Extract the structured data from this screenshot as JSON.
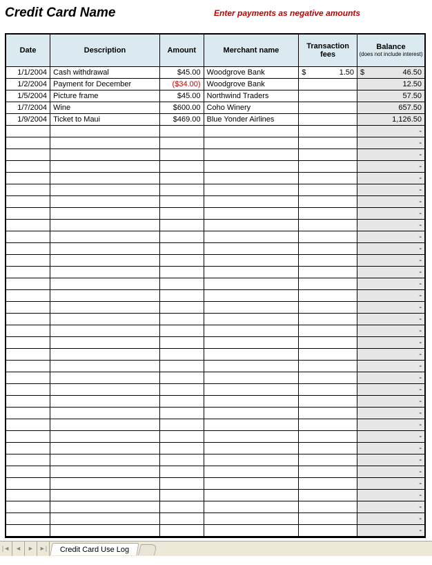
{
  "title": "Credit Card Name",
  "hint": "Enter payments as negative amounts",
  "headers": {
    "date": "Date",
    "desc": "Description",
    "amount": "Amount",
    "merchant": "Merchant name",
    "fees": "Transaction fees",
    "balance": "Balance",
    "balance_sub": "(does not include interest)"
  },
  "rows": [
    {
      "date": "1/1/2004",
      "desc": "Cash withdrawal",
      "amount": "$45.00",
      "neg": false,
      "merchant": "Woodgrove Bank",
      "fees_cur": "$",
      "fees": "1.50",
      "bal_cur": "$",
      "balance": "46.50"
    },
    {
      "date": "1/2/2004",
      "desc": "Payment for December",
      "amount": "($34.00)",
      "neg": true,
      "merchant": "Woodgrove Bank",
      "fees_cur": "",
      "fees": "",
      "bal_cur": "",
      "balance": "12.50"
    },
    {
      "date": "1/5/2004",
      "desc": "Picture frame",
      "amount": "$45.00",
      "neg": false,
      "merchant": "Northwind Traders",
      "fees_cur": "",
      "fees": "",
      "bal_cur": "",
      "balance": "57.50"
    },
    {
      "date": "1/7/2004",
      "desc": "Wine",
      "amount": "$600.00",
      "neg": false,
      "merchant": "Coho Winery",
      "fees_cur": "",
      "fees": "",
      "bal_cur": "",
      "balance": "657.50"
    },
    {
      "date": "1/9/2004",
      "desc": "Ticket to Maui",
      "amount": "$469.00",
      "neg": false,
      "merchant": "Blue Yonder Airlines",
      "fees_cur": "",
      "fees": "",
      "bal_cur": "",
      "balance": "1,126.50"
    }
  ],
  "empty_row_count": 35,
  "empty_balance": "-",
  "sheet_tab": "Credit Card Use Log"
}
